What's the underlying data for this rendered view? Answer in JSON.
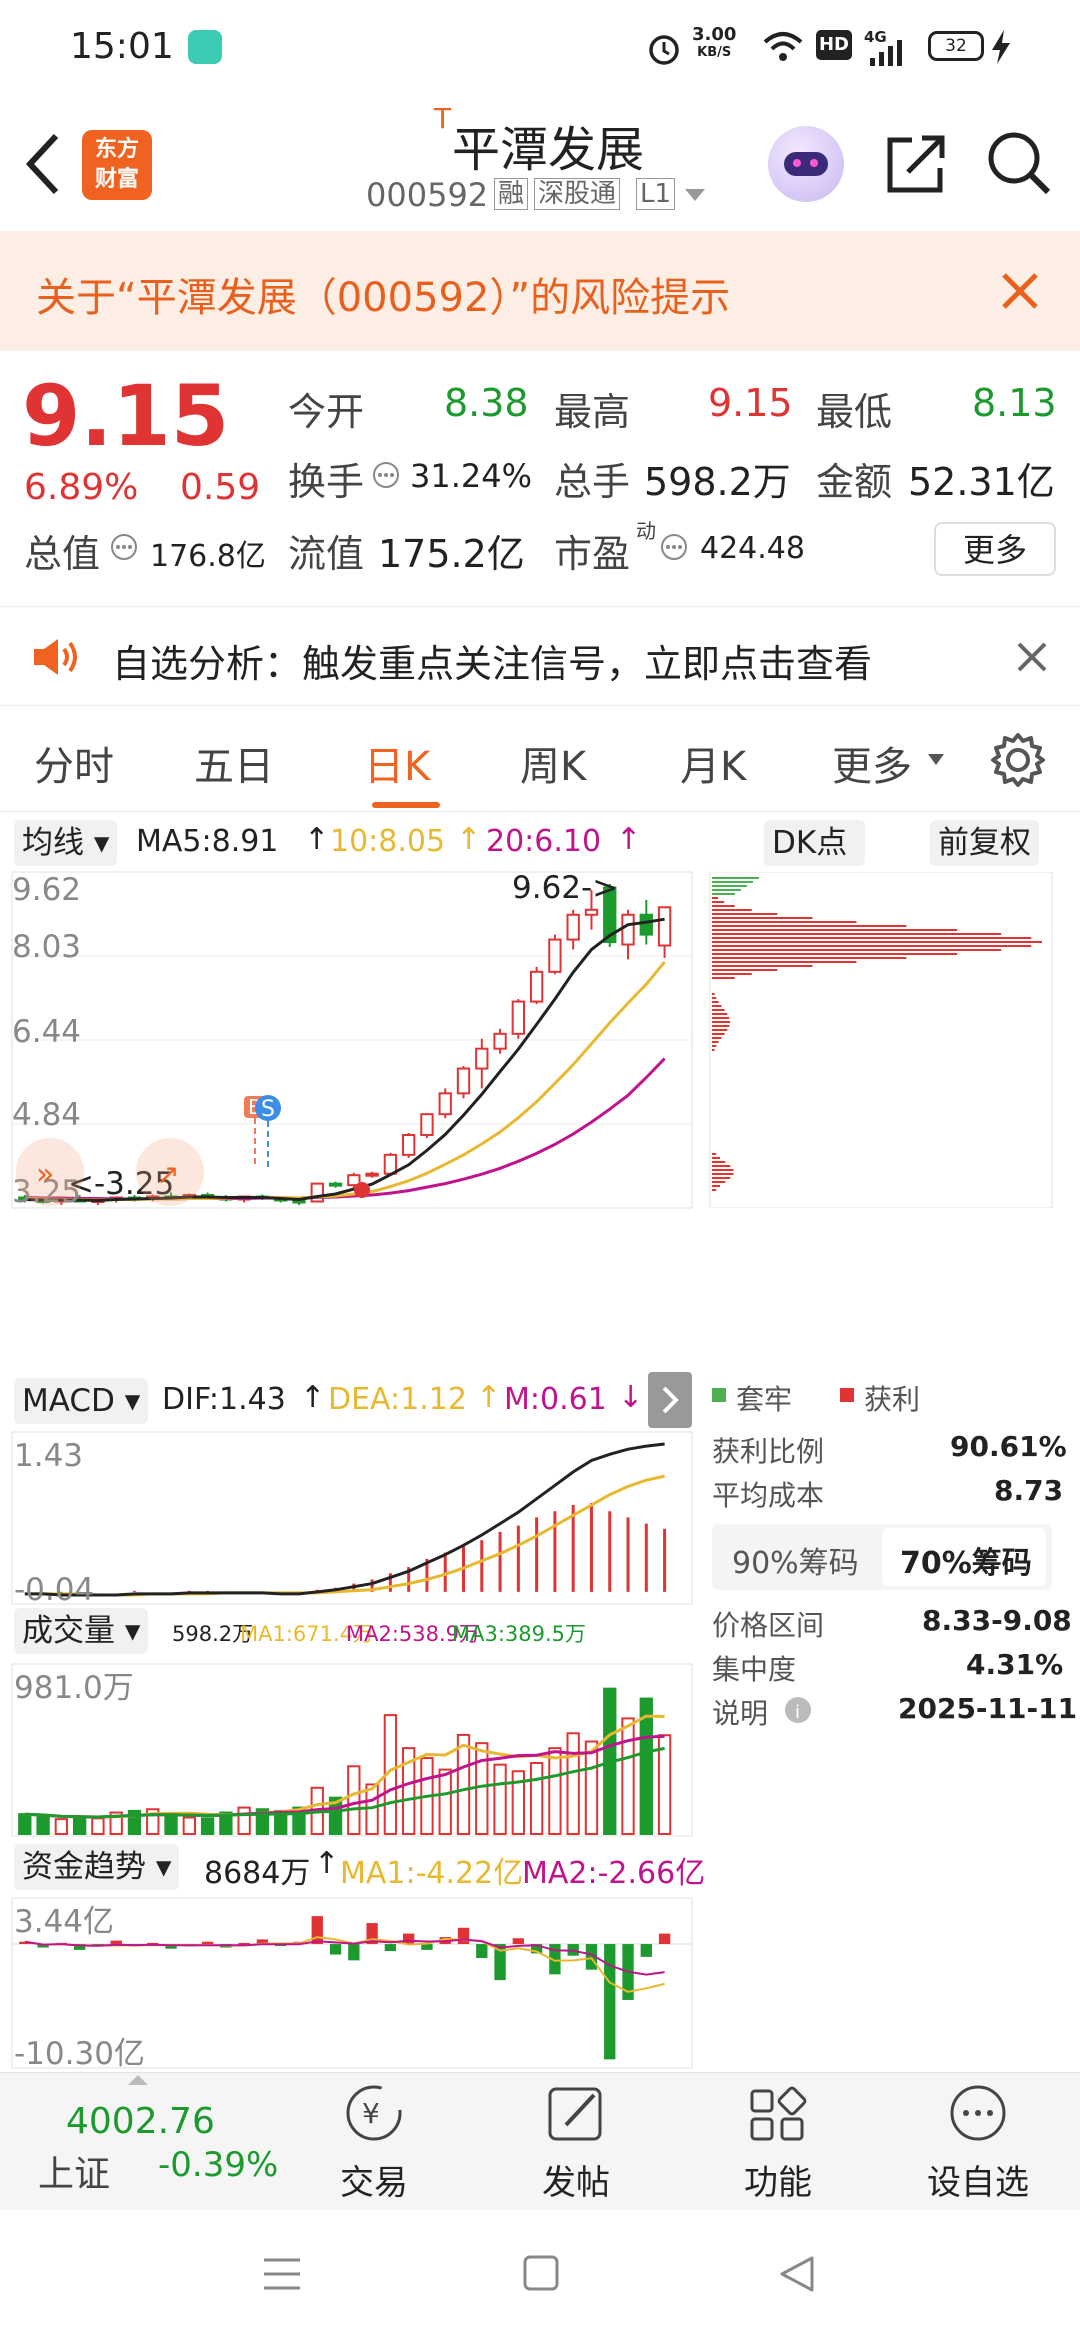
{
  "status": {
    "time": "15:01",
    "net_speed_value": "3.00",
    "net_speed_unit": "KB/S",
    "hd": "HD",
    "signal": "4G",
    "battery": "32"
  },
  "header": {
    "logo_line1": "东方",
    "logo_line2": "财富",
    "title_superscript": "T",
    "title": "平潭发展",
    "code": "000592",
    "tags": [
      "融",
      "深股通",
      "L1"
    ]
  },
  "risk": {
    "text": "关于“平潭发展（000592）”的风险提示"
  },
  "quote": {
    "price": "9.15",
    "change_pct": "6.89%",
    "change": "0.59",
    "rows": [
      {
        "label": "今开",
        "value": "8.38"
      },
      {
        "label": "最高",
        "value": "9.15"
      },
      {
        "label": "最低",
        "value": "8.13"
      },
      {
        "label": "换手",
        "value": "31.24%"
      },
      {
        "label": "总手",
        "value": "598.2万"
      },
      {
        "label": "金额",
        "value": "52.31亿"
      },
      {
        "label": "总值",
        "value": "176.8亿"
      },
      {
        "label": "流值",
        "value": "175.2亿"
      },
      {
        "label": "市盈",
        "sup": "动",
        "value": "424.48"
      }
    ],
    "more": "更多"
  },
  "notice": {
    "text": "自选分析：触发重点关注信号，立即点击查看"
  },
  "tabs": [
    "分时",
    "五日",
    "日K",
    "周K",
    "月K",
    "更多"
  ],
  "tab_active": "日K",
  "kline": {
    "indicator": "均线",
    "ma5": "MA5:8.91",
    "ma10": "10:8.05",
    "ma20": "20:6.10",
    "dk": "DK点",
    "fq": "前复权",
    "ylabels": [
      "9.62",
      "8.03",
      "6.44",
      "4.84",
      "3.25"
    ],
    "high_mark": "9.62",
    "low_mark": "3.25",
    "b": "B",
    "s": "S",
    "colors": {
      "up": "#e03434",
      "down": "#1d9a2e",
      "ma5": "#222222",
      "ma10": "#e8b830",
      "ma20": "#c0148c"
    }
  },
  "chip": {
    "legend_trap": "套牢",
    "legend_profit": "获利",
    "rows": [
      {
        "label": "获利比例",
        "value": "90.61%"
      },
      {
        "label": "平均成本",
        "value": "8.73"
      }
    ],
    "tabs": [
      "90%筹码",
      "70%筹码"
    ],
    "tab_active": "70%筹码",
    "rows2": [
      {
        "label": "价格区间",
        "value": "8.33-9.08"
      },
      {
        "label": "集中度",
        "value": "4.31%"
      },
      {
        "label": "说明",
        "value": "2025-11-11"
      }
    ]
  },
  "macd": {
    "name": "MACD",
    "dif": "DIF:1.43",
    "dea": "DEA:1.12",
    "m": "M:0.61",
    "ymax": "1.43",
    "ymin": "-0.04"
  },
  "volume": {
    "name": "成交量",
    "v": "598.2万",
    "ma1": "MA1:671.4万",
    "ma2": "MA2:538.9万",
    "ma3": "MA3:389.5万",
    "ymax": "981.0万"
  },
  "fund": {
    "name": "资金趋势",
    "v": "8684万",
    "ma1": "MA1:-4.22亿",
    "ma2": "MA2:-2.66亿",
    "ymax": "3.44亿",
    "ymin": "-10.30亿"
  },
  "bottom": {
    "index_value": "4002.76",
    "index_name": "上证",
    "index_change": "-0.39%",
    "items": [
      "交易",
      "发帖",
      "功能",
      "设自选"
    ]
  },
  "chart_data": {
    "type": "candlestick",
    "ohlc": [
      [
        3.3,
        3.35,
        3.2,
        3.25
      ],
      [
        3.25,
        3.3,
        3.18,
        3.22
      ],
      [
        3.22,
        3.3,
        3.15,
        3.28
      ],
      [
        3.28,
        3.35,
        3.2,
        3.22
      ],
      [
        3.22,
        3.3,
        3.15,
        3.25
      ],
      [
        3.25,
        3.32,
        3.2,
        3.3
      ],
      [
        3.3,
        3.35,
        3.22,
        3.28
      ],
      [
        3.28,
        3.36,
        3.22,
        3.32
      ],
      [
        3.32,
        3.4,
        3.25,
        3.3
      ],
      [
        3.3,
        3.38,
        3.25,
        3.35
      ],
      [
        3.35,
        3.4,
        3.28,
        3.3
      ],
      [
        3.3,
        3.35,
        3.22,
        3.26
      ],
      [
        3.26,
        3.34,
        3.2,
        3.32
      ],
      [
        3.32,
        3.36,
        3.25,
        3.28
      ],
      [
        3.28,
        3.32,
        3.2,
        3.24
      ],
      [
        3.24,
        3.3,
        3.15,
        3.22
      ],
      [
        3.22,
        3.6,
        3.2,
        3.58
      ],
      [
        3.58,
        3.62,
        3.5,
        3.55
      ],
      [
        3.55,
        3.8,
        3.5,
        3.75
      ],
      [
        3.75,
        3.82,
        3.7,
        3.78
      ],
      [
        3.78,
        4.2,
        3.76,
        4.16
      ],
      [
        4.16,
        4.6,
        4.1,
        4.56
      ],
      [
        4.56,
        5.0,
        4.5,
        4.98
      ],
      [
        4.98,
        5.5,
        4.9,
        5.4
      ],
      [
        5.4,
        5.95,
        5.3,
        5.9
      ],
      [
        5.9,
        6.5,
        5.5,
        6.3
      ],
      [
        6.3,
        6.7,
        6.2,
        6.6
      ],
      [
        6.6,
        7.3,
        6.5,
        7.25
      ],
      [
        7.25,
        7.95,
        7.2,
        7.85
      ],
      [
        7.85,
        8.6,
        7.8,
        8.5
      ],
      [
        8.5,
        9.1,
        8.3,
        9.0
      ],
      [
        9.0,
        9.5,
        8.7,
        9.1
      ],
      [
        9.55,
        9.62,
        8.35,
        8.45
      ],
      [
        8.4,
        9.1,
        8.1,
        9.0
      ],
      [
        9.0,
        9.3,
        8.4,
        8.6
      ],
      [
        8.38,
        9.15,
        8.13,
        9.15
      ]
    ],
    "ma5": [
      3.26,
      3.25,
      3.25,
      3.25,
      3.24,
      3.26,
      3.27,
      3.28,
      3.29,
      3.31,
      3.31,
      3.3,
      3.3,
      3.3,
      3.28,
      3.26,
      3.32,
      3.37,
      3.47,
      3.57,
      3.76,
      3.96,
      4.25,
      4.57,
      4.96,
      5.38,
      5.84,
      6.29,
      6.79,
      7.3,
      7.84,
      8.3,
      8.58,
      8.8,
      8.85,
      8.91
    ],
    "ma10": [
      3.28,
      3.27,
      3.26,
      3.26,
      3.25,
      3.26,
      3.26,
      3.27,
      3.27,
      3.28,
      3.28,
      3.29,
      3.3,
      3.3,
      3.3,
      3.29,
      3.31,
      3.33,
      3.37,
      3.42,
      3.52,
      3.64,
      3.79,
      3.97,
      4.16,
      4.38,
      4.62,
      4.91,
      5.23,
      5.6,
      5.98,
      6.4,
      6.82,
      7.22,
      7.6,
      8.05
    ],
    "ma20": [
      3.3,
      3.29,
      3.29,
      3.28,
      3.28,
      3.27,
      3.27,
      3.27,
      3.27,
      3.28,
      3.28,
      3.28,
      3.28,
      3.29,
      3.29,
      3.29,
      3.3,
      3.31,
      3.33,
      3.35,
      3.39,
      3.44,
      3.51,
      3.58,
      3.67,
      3.77,
      3.89,
      4.03,
      4.19,
      4.37,
      4.58,
      4.82,
      5.08,
      5.36,
      5.72,
      6.1
    ],
    "ylim": [
      3.25,
      9.62
    ],
    "volume": [
      120,
      110,
      90,
      100,
      95,
      130,
      140,
      150,
      110,
      100,
      95,
      130,
      160,
      150,
      140,
      160,
      280,
      220,
      410,
      300,
      720,
      520,
      460,
      390,
      600,
      550,
      420,
      380,
      430,
      520,
      610,
      560,
      880,
      700,
      820,
      598.2
    ],
    "volume_ylim": [
      0,
      981
    ],
    "dif": [
      -0.02,
      -0.02,
      -0.03,
      -0.03,
      -0.03,
      -0.03,
      -0.02,
      -0.02,
      -0.02,
      -0.01,
      -0.01,
      -0.01,
      -0.01,
      -0.01,
      -0.02,
      -0.02,
      0.0,
      0.02,
      0.05,
      0.08,
      0.14,
      0.2,
      0.28,
      0.36,
      0.45,
      0.55,
      0.66,
      0.77,
      0.9,
      1.03,
      1.16,
      1.27,
      1.33,
      1.38,
      1.41,
      1.43
    ],
    "dea": [
      -0.02,
      -0.02,
      -0.02,
      -0.02,
      -0.03,
      -0.03,
      -0.03,
      -0.02,
      -0.02,
      -0.02,
      -0.02,
      -0.01,
      -0.01,
      -0.01,
      -0.01,
      -0.01,
      -0.01,
      0.0,
      0.01,
      0.02,
      0.05,
      0.08,
      0.12,
      0.17,
      0.23,
      0.3,
      0.37,
      0.45,
      0.54,
      0.64,
      0.74,
      0.84,
      0.94,
      1.02,
      1.08,
      1.12
    ],
    "macd_hist": [
      0,
      0,
      -0.01,
      -0.01,
      0,
      0,
      0.01,
      0,
      0,
      0.01,
      0.01,
      0,
      0,
      0,
      -0.01,
      -0.01,
      0.02,
      0.04,
      0.08,
      0.12,
      0.18,
      0.24,
      0.32,
      0.38,
      0.44,
      0.5,
      0.58,
      0.64,
      0.72,
      0.78,
      0.84,
      0.86,
      0.78,
      0.72,
      0.66,
      0.61
    ],
    "macd_ylim": [
      -0.04,
      1.43
    ],
    "fund": [
      0.2,
      -0.3,
      0.1,
      -0.5,
      -0.2,
      0.3,
      -0.2,
      0.1,
      -0.4,
      -0.2,
      0.2,
      -0.3,
      0.1,
      0.4,
      -0.1,
      0.2,
      2.4,
      -0.9,
      -1.4,
      1.8,
      -0.6,
      0.9,
      -0.5,
      0.6,
      1.4,
      -1.2,
      -3.1,
      0.5,
      -0.8,
      -2.6,
      -1.0,
      -2.2,
      -9.9,
      -4.8,
      -1.1,
      0.9
    ],
    "fund_ylim": [
      -10.3,
      3.44
    ]
  }
}
